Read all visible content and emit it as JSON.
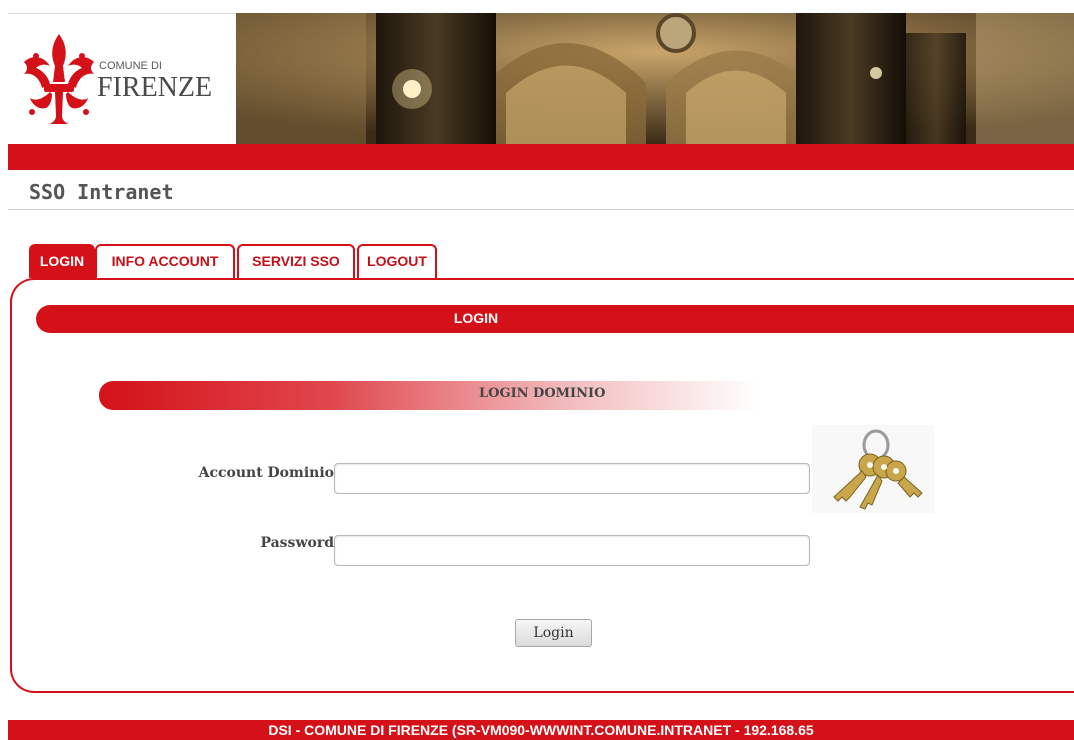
{
  "header": {
    "logo_small": "COMUNE DI",
    "logo_big": "FIRENZE"
  },
  "title": "SSO Intranet",
  "tabs": [
    {
      "label": "LOGIN",
      "active": true
    },
    {
      "label": "INFO ACCOUNT",
      "active": false
    },
    {
      "label": "SERVIZI SSO",
      "active": false
    },
    {
      "label": "LOGOUT",
      "active": false
    }
  ],
  "panel": {
    "header": "LOGIN",
    "subheader": "LOGIN DOMINIO"
  },
  "form": {
    "account_label": "Account Dominio",
    "account_value": "",
    "password_label": "Password",
    "password_value": "",
    "submit_label": "Login"
  },
  "footer": {
    "text": "DSI - COMUNE DI FIRENZE (SR-VM090-WWWINT.COMUNE.INTRANET - 192.168.65"
  },
  "colors": {
    "brand_red": "#d41118",
    "text_gray": "#444444"
  },
  "icons": [
    "fleur-de-lis-logo-icon",
    "keys-icon"
  ]
}
